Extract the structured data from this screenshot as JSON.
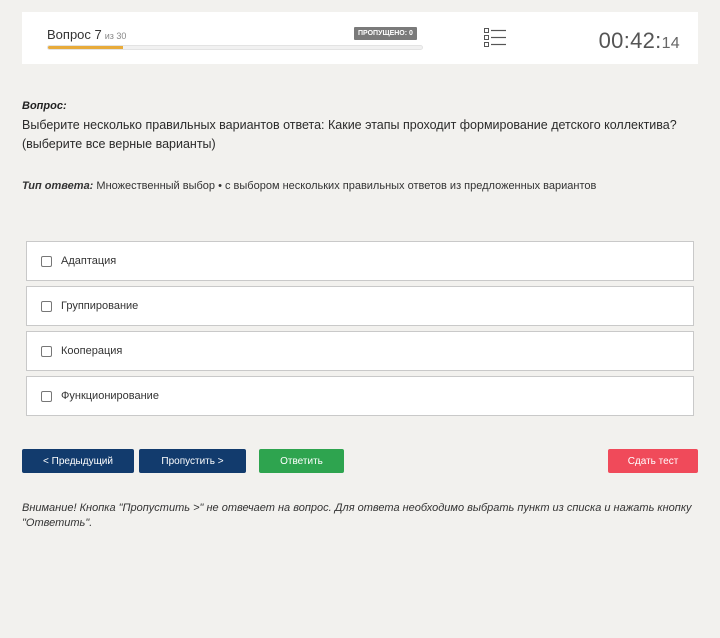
{
  "header": {
    "question_counter": "Вопрос 7",
    "question_total": "из 30",
    "skipped_badge": "ПРОПУЩЕНО: 0",
    "progress_fraction": 0.2,
    "timer_main": "00:42:",
    "timer_ms": "14",
    "list_icon": "list-icon"
  },
  "question": {
    "label": "Вопрос:",
    "text": "Выберите несколько правильных вариантов ответа: Какие этапы проходит формирование детского коллектива? (выберите все верные варианты)",
    "answer_type_label": "Тип ответа:",
    "answer_type_value": " Множественный выбор • с выбором нескольких правильных ответов из предложенных вариантов"
  },
  "options": [
    {
      "label": "Адаптация",
      "checked": false
    },
    {
      "label": "Группирование",
      "checked": false
    },
    {
      "label": "Кооперация",
      "checked": false
    },
    {
      "label": "Функционирование",
      "checked": false
    }
  ],
  "buttons": {
    "prev": "< Предыдущий",
    "skip": "Пропустить >",
    "answer": "Ответить",
    "submit": "Сдать тест"
  },
  "notice": "Внимание! Кнопка \"Пропустить >\" не отвечает на вопрос. Для ответа необходимо выбрать пункт из списка и нажать кнопку \"Ответить\".",
  "colors": {
    "progress": "#e8ab3a",
    "nav_button": "#123b6d",
    "answer_button": "#2ea44f",
    "submit_button": "#f04a5a"
  }
}
